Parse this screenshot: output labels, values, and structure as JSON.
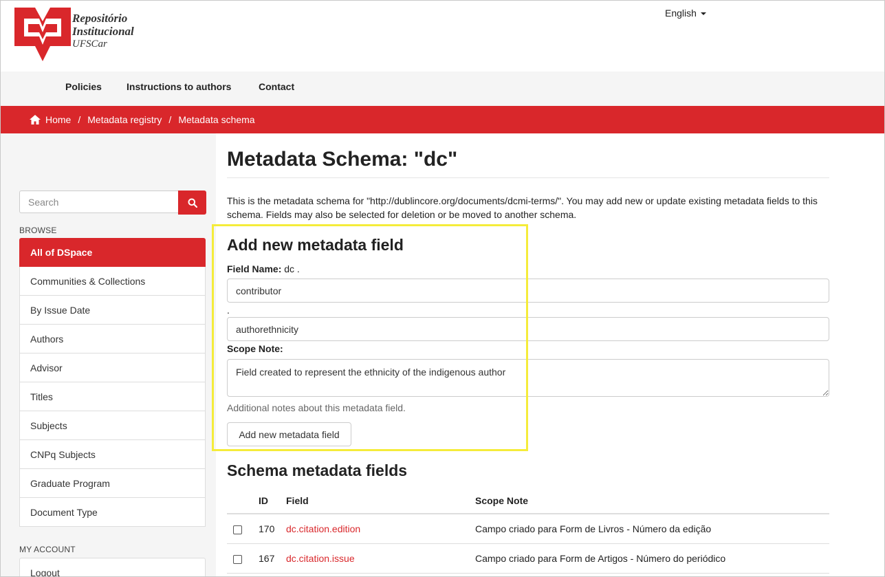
{
  "brand": {
    "line1": "Repositório",
    "line2": "Institucional",
    "line3": "UFSCar",
    "color": "#d9272b"
  },
  "language": {
    "label": "English",
    "icon": "caret-down-icon"
  },
  "nav": {
    "items": [
      "Policies",
      "Instructions to authors",
      "Contact"
    ]
  },
  "breadcrumb": {
    "icon": "home-icon",
    "items": [
      "Home",
      "Metadata registry",
      "Metadata schema"
    ],
    "separator": "/"
  },
  "sidebar": {
    "search_placeholder": "Search",
    "search_icon": "search-icon",
    "browse_heading": "BROWSE",
    "browse_items": [
      "All of DSpace",
      "Communities & Collections",
      "By Issue Date",
      "Authors",
      "Advisor",
      "Titles",
      "Subjects",
      "CNPq Subjects",
      "Graduate Program",
      "Document Type"
    ],
    "active_item": "All of DSpace",
    "account_heading": "MY ACCOUNT",
    "account_items": [
      "Logout"
    ]
  },
  "main": {
    "title": "Metadata Schema: \"dc\"",
    "intro": "This is the metadata schema for \"http://dublincore.org/documents/dcmi-terms/\". You may add new or update existing metadata fields to this schema. Fields may also be selected for deletion or be moved to another schema.",
    "form": {
      "heading": "Add new metadata field",
      "field_name_label": "Field Name:",
      "field_name_prefix": "dc .",
      "element_value": "contributor",
      "separator": ".",
      "qualifier_value": "authorethnicity",
      "scope_note_label": "Scope Note:",
      "scope_note_value": "Field created to represent the ethnicity of the indigenous author",
      "help_text": "Additional notes about this metadata field.",
      "submit_label": "Add new metadata field",
      "highlight_color": "#f5ec3a"
    },
    "fields_heading": "Schema metadata fields",
    "table": {
      "headers": [
        "ID",
        "Field",
        "Scope Note"
      ],
      "rows": [
        {
          "id": "170",
          "field": "dc.citation.edition",
          "note": "Campo criado para Form de Livros - Número da edição"
        },
        {
          "id": "167",
          "field": "dc.citation.issue",
          "note": "Campo criado para Form de Artigos - Número do periódico"
        }
      ]
    }
  }
}
